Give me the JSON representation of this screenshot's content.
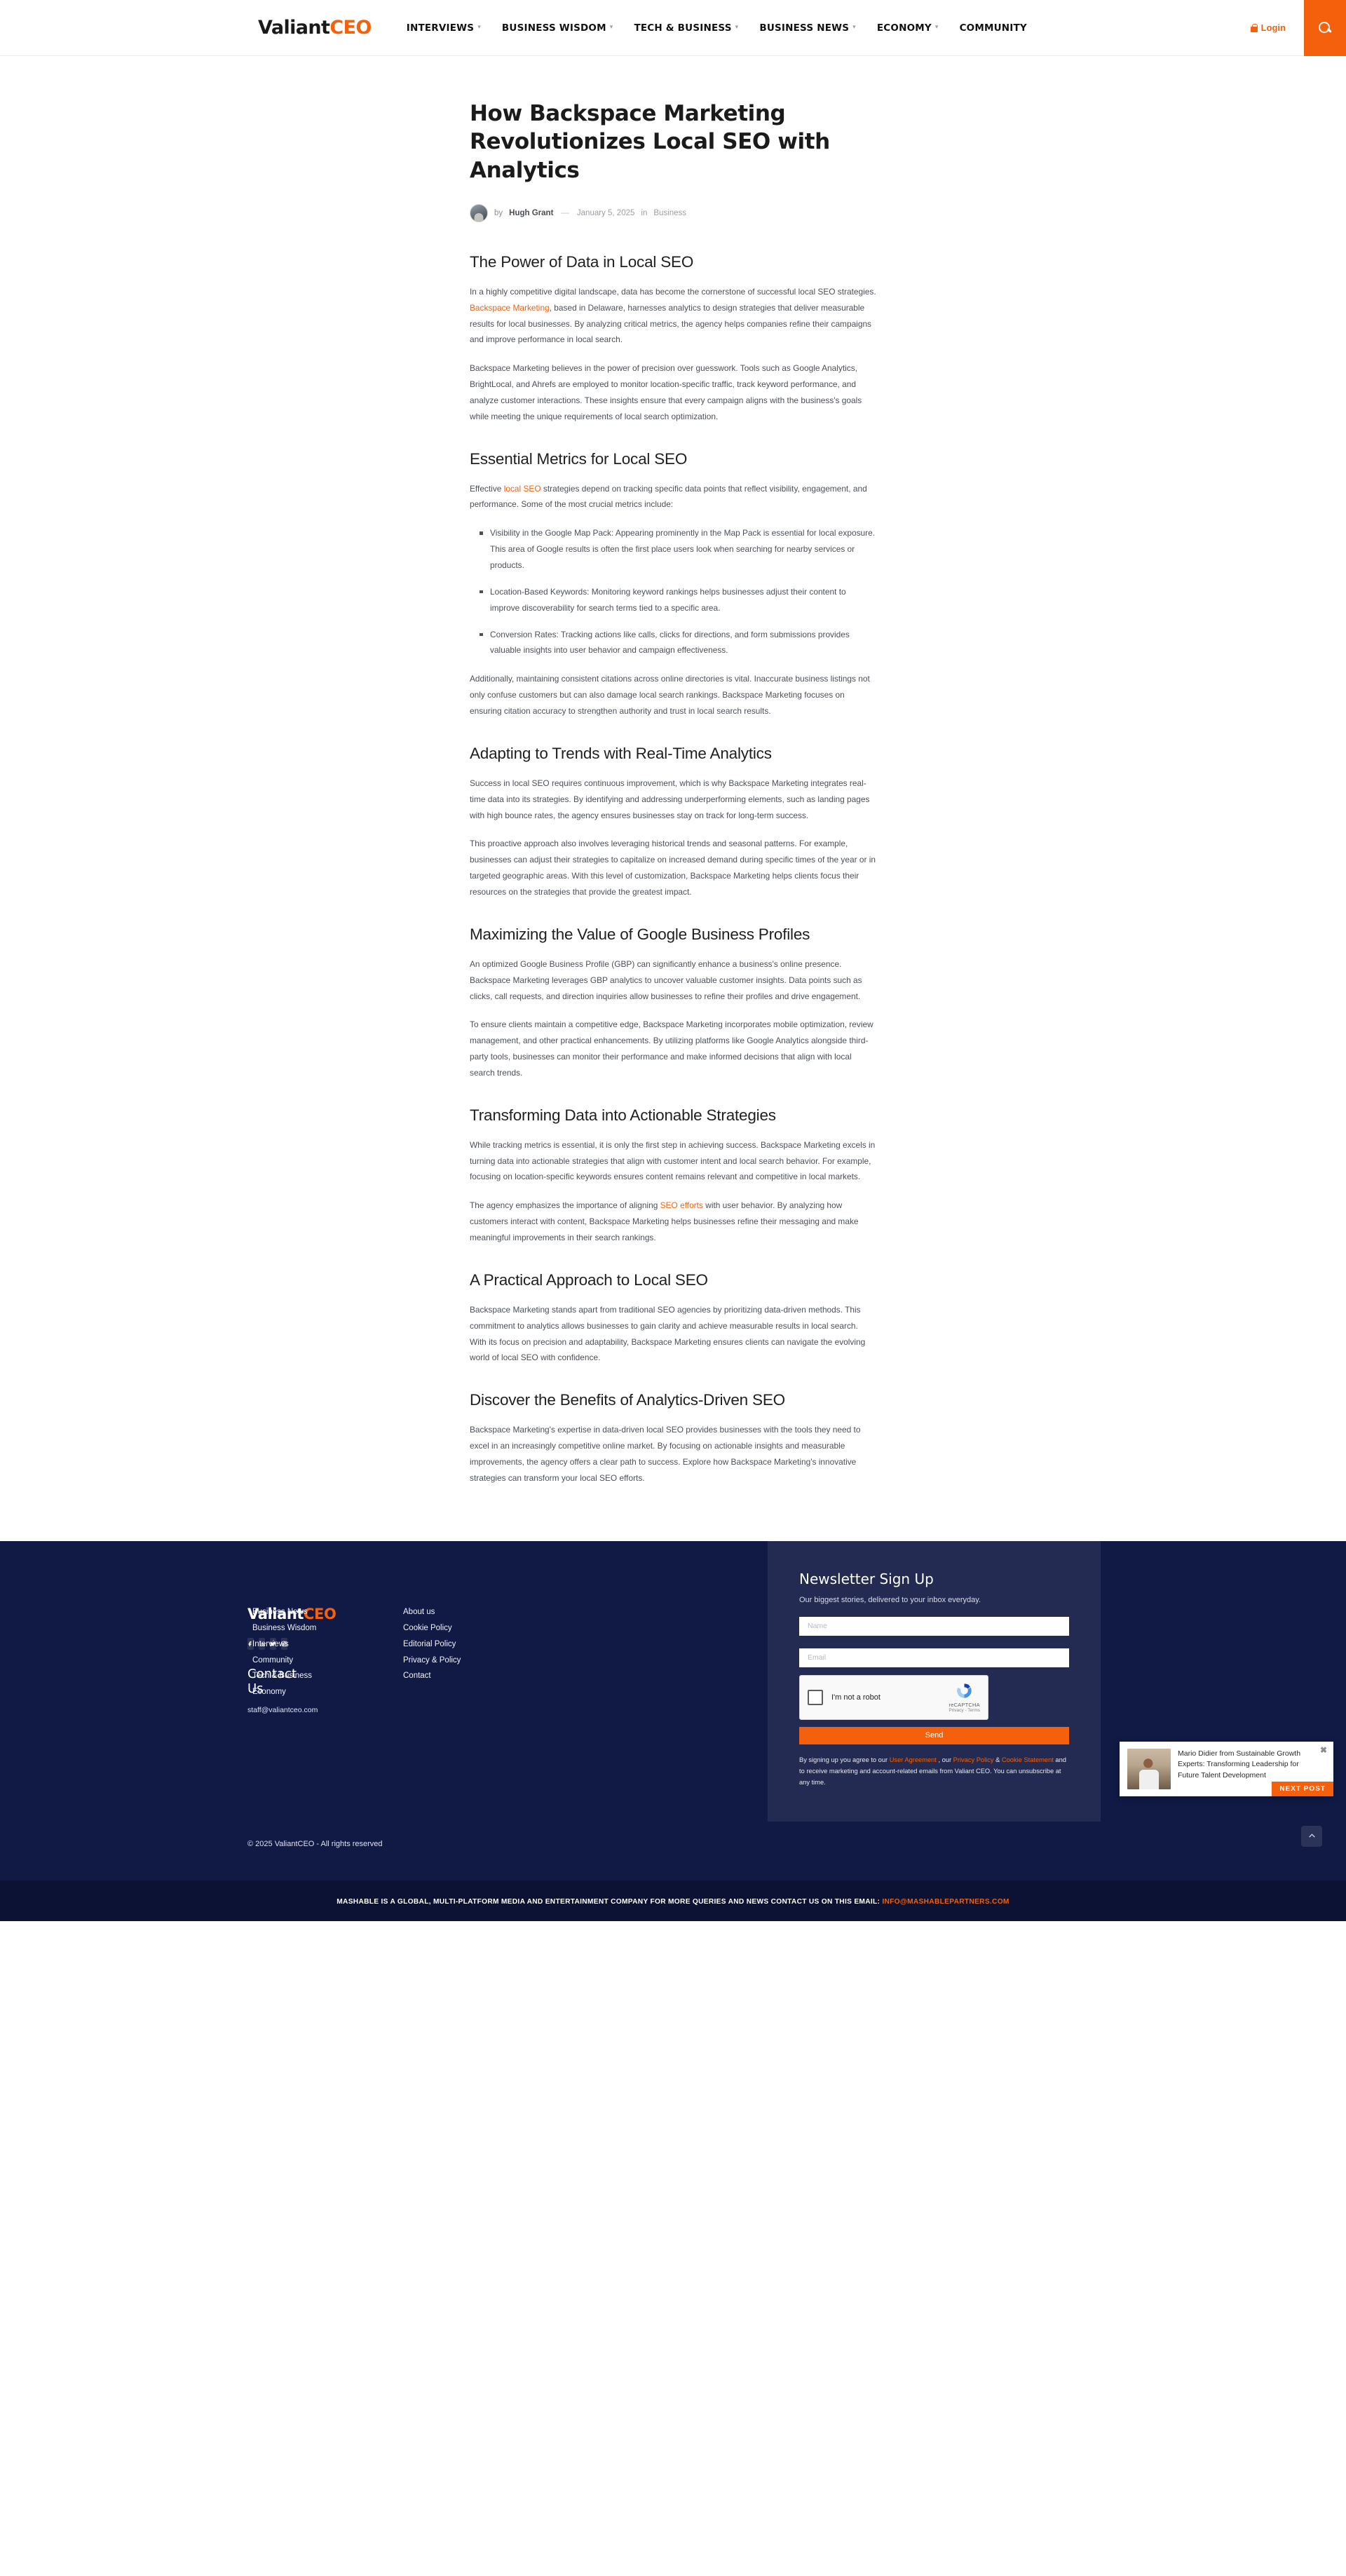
{
  "header": {
    "brand_dark": "Valiant",
    "brand_accent": "CEO",
    "nav": [
      {
        "label": "INTERVIEWS",
        "has_caret": true
      },
      {
        "label": "BUSINESS WISDOM",
        "has_caret": true
      },
      {
        "label": "TECH & BUSINESS",
        "has_caret": true
      },
      {
        "label": "BUSINESS NEWS",
        "has_caret": true
      },
      {
        "label": "ECONOMY",
        "has_caret": true
      },
      {
        "label": "COMMUNITY",
        "has_caret": false
      }
    ],
    "login_label": "Login",
    "search_icon": "search-icon"
  },
  "article": {
    "title": "How Backspace Marketing Revolutionizes Local SEO with Analytics",
    "byline": {
      "by": "by",
      "author": "Hugh Grant",
      "dash": "—",
      "date": "January 5, 2025",
      "in": "in",
      "category": "Business"
    },
    "sections": [
      {
        "heading": "The Power of Data in Local SEO",
        "paragraphs": [
          "In a highly competitive digital landscape, data has become the cornerstone of successful local SEO strategies. Backspace Marketing, based in Delaware, harnesses analytics to design strategies that deliver measurable results for local businesses. By analyzing critical metrics, the agency helps companies refine their campaigns and improve performance in local search.",
          "Backspace Marketing believes in the power of precision over guesswork. Tools such as Google Analytics, BrightLocal, and Ahrefs are employed to monitor location-specific traffic, track keyword performance, and analyze customer interactions. These insights ensure that every campaign aligns with the business's goals while meeting the unique requirements of local search optimization."
        ]
      },
      {
        "heading": "Essential Metrics for Local SEO",
        "paragraphs": [
          "Effective local SEO strategies depend on tracking specific data points that reflect visibility, engagement, and performance. Some of the most crucial metrics include:"
        ],
        "bullets": [
          "Visibility in the Google Map Pack: Appearing prominently in the Map Pack is essential for local exposure. This area of Google results is often the first place users look when searching for nearby services or products.",
          "Location-Based Keywords: Monitoring keyword rankings helps businesses adjust their content to improve discoverability for search terms tied to a specific area.",
          "Conversion Rates: Tracking actions like calls, clicks for directions, and form submissions provides valuable insights into user behavior and campaign effectiveness."
        ],
        "paragraphs_after": [
          "Additionally, maintaining consistent citations across online directories is vital. Inaccurate business listings not only confuse customers but can also damage local search rankings. Backspace Marketing focuses on ensuring citation accuracy to strengthen authority and trust in local search results."
        ]
      },
      {
        "heading": "Adapting to Trends with Real-Time Analytics",
        "paragraphs": [
          "Success in local SEO requires continuous improvement, which is why Backspace Marketing integrates real-time data into its strategies. By identifying and addressing underperforming elements, such as landing pages with high bounce rates, the agency ensures businesses stay on track for long-term success.",
          "This proactive approach also involves leveraging historical trends and seasonal patterns. For example, businesses can adjust their strategies to capitalize on increased demand during specific times of the year or in targeted geographic areas. With this level of customization, Backspace Marketing helps clients focus their resources on the strategies that provide the greatest impact."
        ]
      },
      {
        "heading": "Maximizing the Value of Google Business Profiles",
        "paragraphs": [
          "An optimized Google Business Profile (GBP) can significantly enhance a business's online presence. Backspace Marketing leverages GBP analytics to uncover valuable customer insights. Data points such as clicks, call requests, and direction inquiries allow businesses to refine their profiles and drive engagement.",
          "To ensure clients maintain a competitive edge, Backspace Marketing incorporates mobile optimization, review management, and other practical enhancements. By utilizing platforms like Google Analytics alongside third-party tools, businesses can monitor their performance and make informed decisions that align with local search trends."
        ]
      },
      {
        "heading": "Transforming Data into Actionable Strategies",
        "paragraphs": [
          "While tracking metrics is essential, it is only the first step in achieving success. Backspace Marketing excels in turning data into actionable strategies that align with customer intent and local search behavior. For example, focusing on location-specific keywords ensures content remains relevant and competitive in local markets.",
          "The agency emphasizes the importance of aligning SEO efforts with user behavior. By analyzing how customers interact with content, Backspace Marketing helps businesses refine their messaging and make meaningful improvements in their search rankings."
        ]
      },
      {
        "heading": "A Practical Approach to Local SEO",
        "paragraphs": [
          "Backspace Marketing stands apart from traditional SEO agencies by prioritizing data-driven methods. This commitment to analytics allows businesses to gain clarity and achieve measurable results in local search. With its focus on precision and adaptability, Backspace Marketing ensures clients can navigate the evolving world of local SEO with confidence."
        ]
      },
      {
        "heading": "Discover the Benefits of Analytics-Driven SEO",
        "paragraphs": [
          "Backspace Marketing's expertise in data-driven local SEO provides businesses with the tools they need to excel in an increasingly competitive online market. By focusing on actionable insights and measurable improvements, the agency offers a clear path to success. Explore how Backspace Marketing's innovative strategies can transform your local SEO efforts."
        ]
      }
    ],
    "inline_links": {
      "backspace_marketing": "Backspace Marketing",
      "local_seo": "local SEO",
      "seo_efforts": "SEO efforts"
    }
  },
  "footer": {
    "brand_dark": "Valiant",
    "brand_accent": "CEO",
    "socials": [
      {
        "name": "facebook-icon"
      },
      {
        "name": "linkedin-icon"
      },
      {
        "name": "twitter-icon"
      },
      {
        "name": "instagram-icon"
      }
    ],
    "contact_heading": "Contact Us",
    "contact_email": "staff@valiantceo.com",
    "links_col1": [
      "Business News",
      "Business Wisdom",
      "Interviews",
      "Community",
      "Tech & Business",
      "Economy"
    ],
    "links_col2": [
      "About us",
      "Cookie Policy",
      "Editorial Policy",
      "Privacy & Policy",
      "Contact"
    ],
    "newsletter": {
      "title": "Newsletter Sign Up",
      "subtitle": "Our biggest stories, delivered to your inbox everyday.",
      "name_placeholder": "Name",
      "email_placeholder": "Email",
      "recaptcha_label": "I'm not a robot",
      "recaptcha_brand": "reCAPTCHA",
      "recaptcha_terms": "Privacy - Terms",
      "send_label": "Send",
      "fine_print_1": "By signing up you agree to our ",
      "fine_link_1": "User Agreement",
      "fine_print_2": " , our ",
      "fine_link_2": "Privacy Policy",
      "fine_print_3": " & ",
      "fine_link_3": "Cookie Statement",
      "fine_print_4": " and to receive marketing and account-related emails from Valiant CEO. You can unsubscribe at any time."
    },
    "copyright": "© 2025 ValiantCEO - All rights reserved",
    "bottom_text": "MASHABLE IS A GLOBAL, MULTI-PLATFORM MEDIA AND ENTERTAINMENT COMPANY FOR MORE QUERIES AND NEWS CONTACT US ON THIS EMAIL: ",
    "bottom_mail": "INFO@MASHABLEPARTNERS.COM"
  },
  "next_post": {
    "title": "Mario Didier from Sustainable Growth Experts: Transforming Leadership for Future Talent Development",
    "button_label": "NEXT POST",
    "close_label": "✖"
  },
  "colors": {
    "accent": "#f4600b",
    "footer_bg": "#101a45",
    "newsletter_bg": "#232b52",
    "bottom_bar_bg": "#0b1234"
  }
}
